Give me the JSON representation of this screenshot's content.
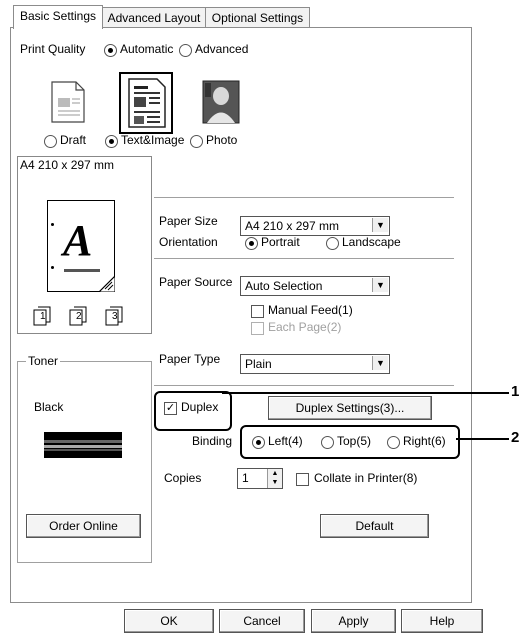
{
  "tabs": [
    {
      "label": "Basic Settings",
      "active": true
    },
    {
      "label": "Advanced Layout",
      "active": false
    },
    {
      "label": "Optional Settings",
      "active": false
    }
  ],
  "print_quality": {
    "label": "Print Quality",
    "mode_options": [
      {
        "label": "Automatic",
        "selected": true
      },
      {
        "label": "Advanced",
        "selected": false
      }
    ],
    "type_options": [
      {
        "label": "Draft",
        "selected": false,
        "icon": "draft-document-icon"
      },
      {
        "label": "Text&Image",
        "selected": true,
        "icon": "text-image-document-icon"
      },
      {
        "label": "Photo",
        "selected": false,
        "icon": "photo-portrait-icon"
      }
    ]
  },
  "preview": {
    "size_label": "A4 210 x 297 mm",
    "letter": "A",
    "page_icons": [
      "1",
      "2",
      "3"
    ]
  },
  "toner": {
    "legend": "Toner",
    "color": "Black",
    "order_button": "Order Online"
  },
  "paper": {
    "size_label": "Paper Size",
    "size_value": "A4 210 x 297 mm",
    "orientation_label": "Orientation",
    "orientation_options": [
      {
        "label": "Portrait",
        "selected": true
      },
      {
        "label": "Landscape",
        "selected": false
      }
    ],
    "source_label": "Paper Source",
    "source_value": "Auto Selection",
    "manual_feed": {
      "label": "Manual Feed(1)",
      "checked": false,
      "enabled": true
    },
    "each_page": {
      "label": "Each Page(2)",
      "checked": false,
      "enabled": false
    },
    "type_label": "Paper Type",
    "type_value": "Plain"
  },
  "duplex": {
    "label": "Duplex",
    "checked": true,
    "settings_button": "Duplex Settings(3)...",
    "binding_label": "Binding",
    "binding_options": [
      {
        "label": "Left(4)",
        "selected": true
      },
      {
        "label": "Top(5)",
        "selected": false
      },
      {
        "label": "Right(6)",
        "selected": false
      }
    ]
  },
  "copies": {
    "label": "Copies",
    "value": "1",
    "collate_label": "Collate in Printer(8)",
    "collate_checked": false
  },
  "default_button": "Default",
  "footer": {
    "ok": "OK",
    "cancel": "Cancel",
    "apply": "Apply",
    "help": "Help"
  },
  "callouts": [
    "1",
    "2"
  ]
}
